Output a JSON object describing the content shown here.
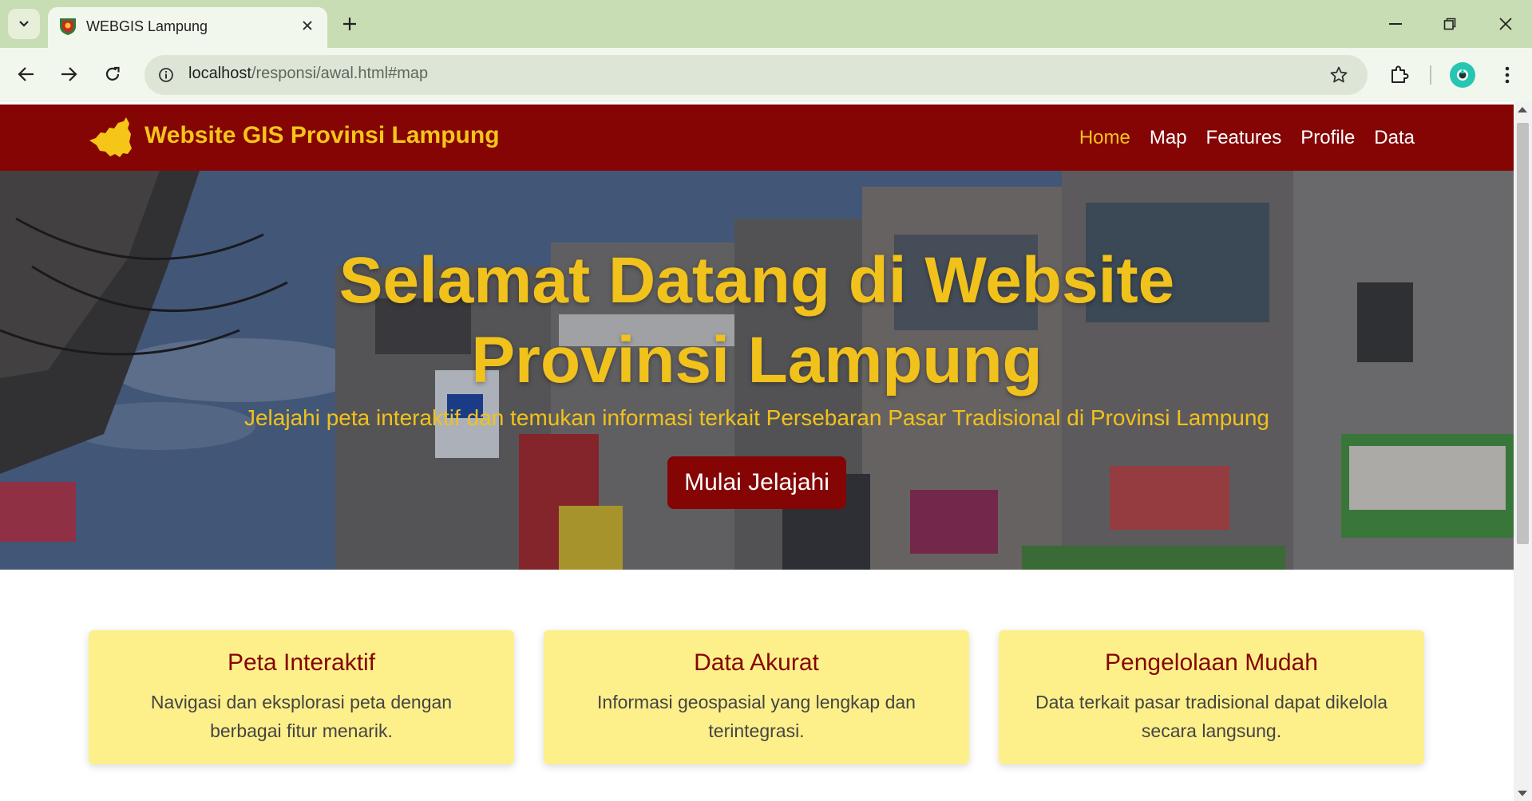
{
  "browser": {
    "tab_title": "WEBGIS Lampung",
    "url_host": "localhost",
    "url_path": "/responsi/awal.html#map"
  },
  "site": {
    "brand": "Website GIS Provinsi Lampung",
    "nav": [
      {
        "label": "Home",
        "active": true
      },
      {
        "label": "Map",
        "active": false
      },
      {
        "label": "Features",
        "active": false
      },
      {
        "label": "Profile",
        "active": false
      },
      {
        "label": "Data",
        "active": false
      }
    ]
  },
  "hero": {
    "title_line1": "Selamat Datang di Website",
    "title_line2": "Provinsi Lampung",
    "subtitle": "Jelajahi peta interaktif dan temukan informasi terkait Persebaran Pasar Tradisional di Provinsi Lampung",
    "button": "Mulai Jelajahi"
  },
  "features": [
    {
      "title": "Peta Interaktif",
      "description": "Navigasi dan eksplorasi peta dengan berbagai fitur menarik."
    },
    {
      "title": "Data Akurat",
      "description": "Informasi geospasial yang lengkap dan terintegrasi."
    },
    {
      "title": "Pengelolaan Mudah",
      "description": "Data terkait pasar tradisional dapat dikelola secara langsung."
    }
  ],
  "colors": {
    "primary": "#850505",
    "accent": "#f5c518",
    "card": "#fdf08a"
  },
  "icons": [
    "chevron-down-icon",
    "close-icon",
    "plus-icon",
    "minimize-icon",
    "restore-icon",
    "back-icon",
    "forward-icon",
    "reload-icon",
    "info-icon",
    "star-icon",
    "extensions-icon",
    "profile-icon",
    "more-vert-icon",
    "lampung-map-logo"
  ]
}
